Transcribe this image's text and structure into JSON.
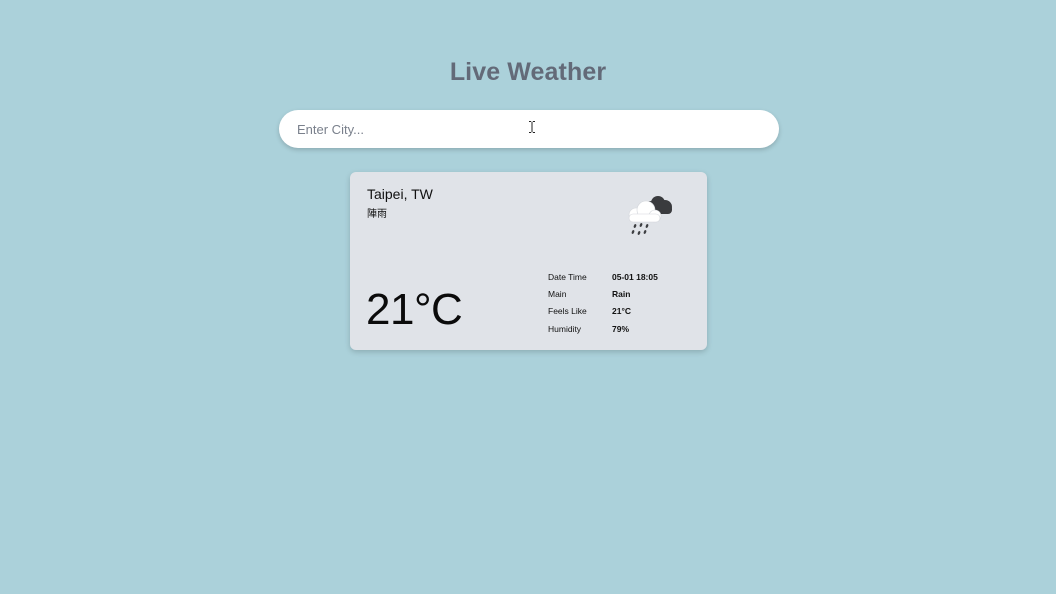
{
  "header": {
    "title": "Live Weather"
  },
  "search": {
    "placeholder": "Enter City...",
    "value": ""
  },
  "card": {
    "city": "Taipei, TW",
    "description": "陣雨",
    "icon": "rain-cloud-icon",
    "temperature": "21°C",
    "details": [
      {
        "label": "Date Time",
        "value": "05-01 18:05"
      },
      {
        "label": "Main",
        "value": "Rain"
      },
      {
        "label": "Feels Like",
        "value": "21°C"
      },
      {
        "label": "Humidity",
        "value": "79%"
      }
    ]
  },
  "colors": {
    "background": "#abd1da",
    "title": "#636a78",
    "card": "#e0e3e8"
  }
}
